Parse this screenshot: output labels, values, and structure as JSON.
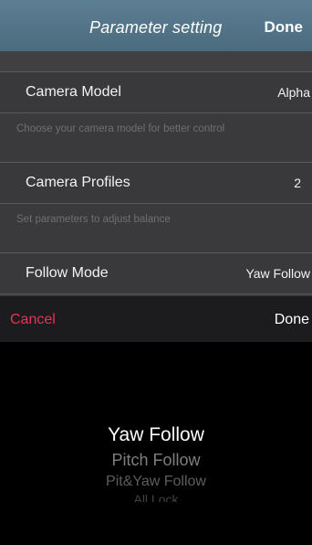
{
  "navbar": {
    "title": "Parameter setting",
    "done_label": "Done"
  },
  "settings": {
    "rows": [
      {
        "label": "Camera Model",
        "value": "Alpha"
      },
      {
        "label": "Camera Profiles",
        "value": "2"
      },
      {
        "label": "Follow Mode",
        "value": "Yaw Follow"
      }
    ],
    "hints": [
      "Choose your camera model for better control",
      "Set parameters to adjust balance"
    ]
  },
  "picker": {
    "cancel_label": "Cancel",
    "done_label": "Done",
    "options": [
      "Yaw Follow",
      "Pitch Follow",
      "Pit&Yaw Follow",
      "All Lock"
    ],
    "selected": "Yaw Follow"
  },
  "colors": {
    "navbar": "#56788b",
    "cancel": "#e8315a",
    "panel": "#39393b"
  }
}
